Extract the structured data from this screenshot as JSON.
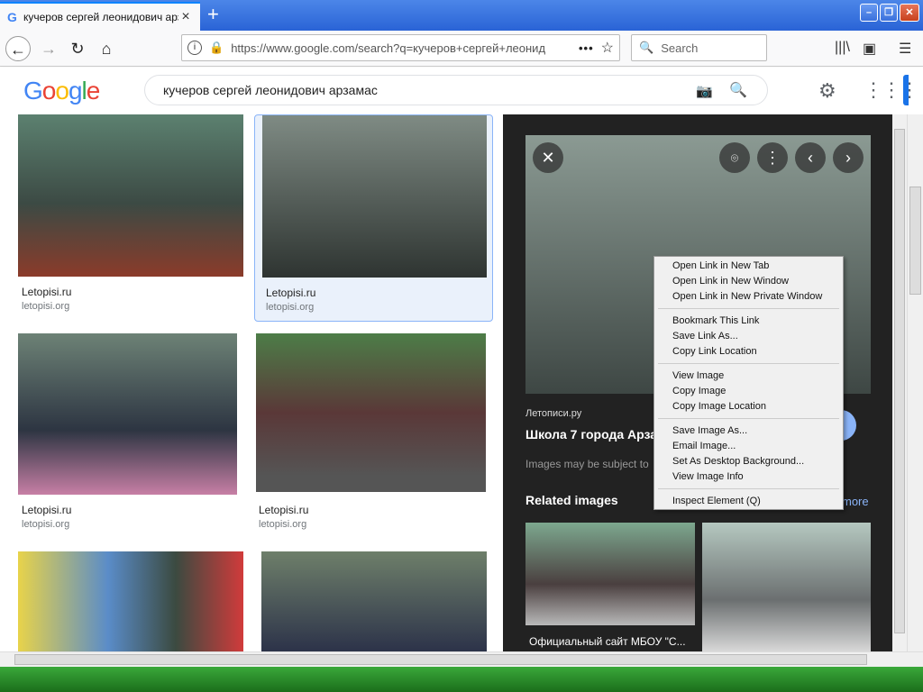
{
  "browser": {
    "tab_title": "кучеров сергей леонидович арзама",
    "url": "https://www.google.com/search?q=кучеров+сергей+леонид",
    "search_placeholder": "Search"
  },
  "google": {
    "logo": "Google",
    "query": "кучеров сергей леонидович арзамас"
  },
  "results": [
    {
      "title": "Letopisi.ru",
      "source": "letopisi.org"
    },
    {
      "title": "Letopisi.ru",
      "source": "letopisi.org"
    },
    {
      "title": "Letopisi.ru",
      "source": "letopisi.org"
    },
    {
      "title": "Letopisi.ru",
      "source": "letopisi.org"
    }
  ],
  "panel": {
    "site": "Летописи.ру",
    "title": "Школа 7 города Арза",
    "notice": "Images may be subject to",
    "related": "Related images",
    "more": "more",
    "related_caption": "Официальный сайт МБОУ \"С..."
  },
  "context_menu": {
    "items": [
      "Open Link in New Tab",
      "Open Link in New Window",
      "Open Link in New Private Window",
      "Bookmark This Link",
      "Save Link As...",
      "Copy Link Location",
      "View Image",
      "Copy Image",
      "Copy Image Location",
      "Save Image As...",
      "Email Image...",
      "Set As Desktop Background...",
      "View Image Info",
      "Inspect Element (Q)"
    ]
  }
}
